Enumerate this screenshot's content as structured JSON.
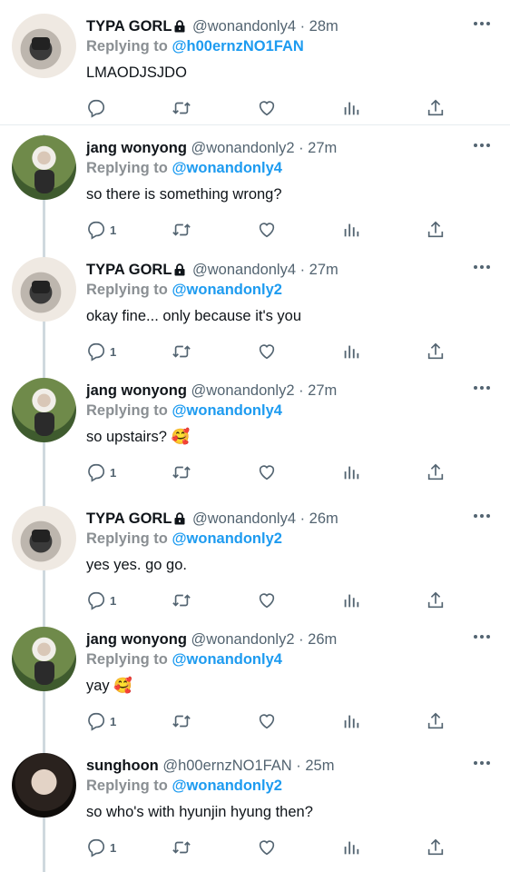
{
  "tweets": [
    {
      "avatar": "typa",
      "name": "TYPA GORL",
      "locked": true,
      "handle": "@wonandonly4 · 28m",
      "replying_label": "Replying to",
      "replying_to": "@h00ernzNO1FAN",
      "text": "LMAODJSJDO",
      "reply_count": ""
    },
    {
      "avatar": "jang",
      "name": "jang wonyong",
      "locked": false,
      "handle": "@wonandonly2 · 27m",
      "replying_label": "Replying to",
      "replying_to": "@wonandonly4",
      "text": "so there is something wrong?",
      "reply_count": "1"
    },
    {
      "avatar": "typa",
      "name": "TYPA GORL",
      "locked": true,
      "handle": "@wonandonly4 · 27m",
      "replying_label": "Replying to",
      "replying_to": "@wonandonly2",
      "text": "okay fine... only because it's you",
      "reply_count": "1"
    },
    {
      "avatar": "jang",
      "name": "jang wonyong",
      "locked": false,
      "handle": "@wonandonly2 · 27m",
      "replying_label": "Replying to",
      "replying_to": "@wonandonly4",
      "text": "so upstairs? 🥰",
      "reply_count": "1"
    },
    {
      "avatar": "typa",
      "name": "TYPA GORL",
      "locked": true,
      "handle": "@wonandonly4 · 26m",
      "replying_label": "Replying to",
      "replying_to": "@wonandonly2",
      "text": "yes yes. go go.",
      "reply_count": "1"
    },
    {
      "avatar": "jang",
      "name": "jang wonyong",
      "locked": false,
      "handle": "@wonandonly2 · 26m",
      "replying_label": "Replying to",
      "replying_to": "@wonandonly4",
      "text": "yay 🥰",
      "reply_count": "1"
    },
    {
      "avatar": "sung",
      "name": "sunghoon",
      "locked": false,
      "handle": "@h00ernzNO1FAN · 25m",
      "replying_label": "Replying to",
      "replying_to": "@wonandonly2",
      "text": "so who's with hyunjin hyung then?",
      "reply_count": "1"
    }
  ],
  "icons": {
    "reply": "reply-icon",
    "retweet": "retweet-icon",
    "like": "heart-icon",
    "views": "views-icon",
    "share": "share-icon",
    "more": "more-icon",
    "lock": "lock-icon"
  },
  "colors": {
    "link": "#1d9bf0",
    "muted": "#536471",
    "thread_line": "#cfd9de"
  }
}
